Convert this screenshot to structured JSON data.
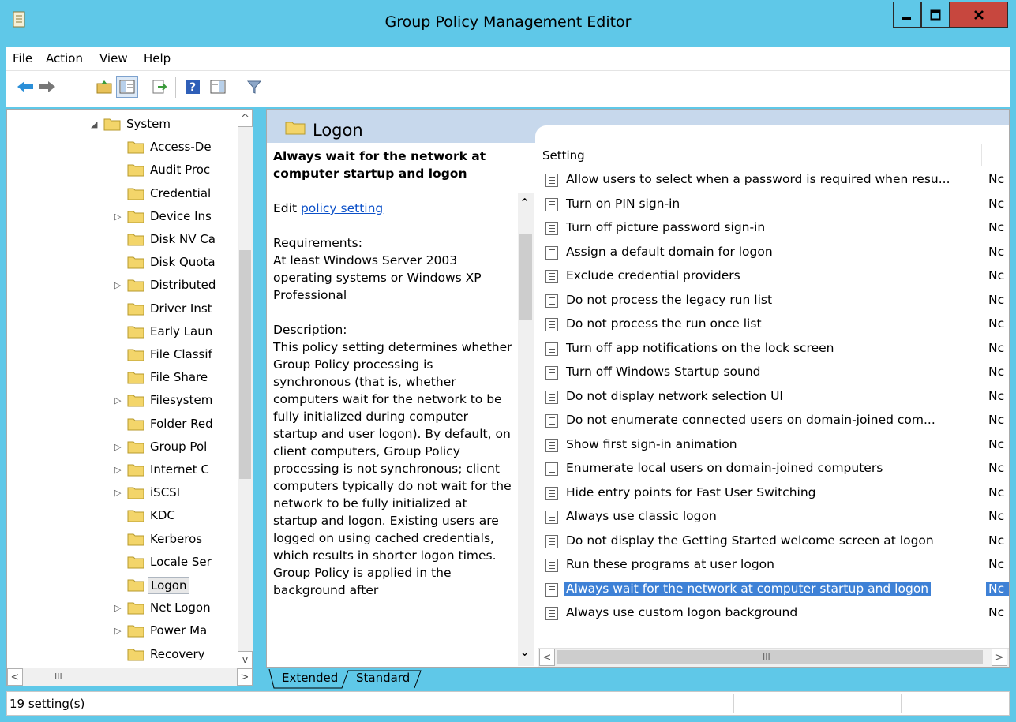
{
  "window": {
    "title": "Group Policy Management Editor"
  },
  "menubar": [
    "File",
    "Action",
    "View",
    "Help"
  ],
  "toolbar": {
    "icons": [
      "back-arrow-icon",
      "forward-arrow-icon",
      "up-folder-icon",
      "show-hide-tree-icon",
      "export-list-icon",
      "help-icon",
      "show-action-pane-icon",
      "filter-icon"
    ]
  },
  "tree": {
    "items": [
      {
        "label": "System",
        "expanded": true
      },
      {
        "label": "Access-De"
      },
      {
        "label": "Audit Proc"
      },
      {
        "label": "Credential"
      },
      {
        "label": "Device Ins",
        "collapsed": true
      },
      {
        "label": "Disk NV Ca"
      },
      {
        "label": "Disk Quota"
      },
      {
        "label": "Distributed",
        "collapsed": true
      },
      {
        "label": "Driver Inst"
      },
      {
        "label": "Early Laun"
      },
      {
        "label": "File Classif"
      },
      {
        "label": "File Share "
      },
      {
        "label": "Filesystem",
        "collapsed": true
      },
      {
        "label": "Folder Red"
      },
      {
        "label": "Group Pol",
        "collapsed": true
      },
      {
        "label": "Internet C",
        "collapsed": true
      },
      {
        "label": "iSCSI",
        "collapsed": true
      },
      {
        "label": "KDC"
      },
      {
        "label": "Kerberos"
      },
      {
        "label": "Locale Ser"
      },
      {
        "label": "Logon",
        "selected": true
      },
      {
        "label": "Net Logon",
        "collapsed": true
      },
      {
        "label": "Power Ma",
        "collapsed": true
      },
      {
        "label": "Recovery"
      }
    ]
  },
  "pane": {
    "title": "Logon",
    "description": {
      "heading": "Always wait for the network at computer startup and logon",
      "edit_prefix": "Edit ",
      "edit_link": "policy setting",
      "requirements_label": "Requirements:",
      "requirements_text": "At least Windows Server 2003 operating systems or Windows XP Professional",
      "description_label": "Description:",
      "description_text": "This policy setting determines whether Group Policy processing is synchronous (that is, whether computers wait for the network to be fully initialized during computer startup and user logon). By default, on client computers, Group Policy processing is not synchronous; client computers typically do not wait for the network to be fully initialized at startup and logon. Existing users are logged on using cached credentials, which results in shorter logon times. Group Policy is applied in the background after"
    },
    "column_setting": "Setting",
    "settings": [
      {
        "name": "Allow users to select when a password is required when resu...",
        "state": "Nc"
      },
      {
        "name": "Turn on PIN sign-in",
        "state": "Nc"
      },
      {
        "name": "Turn off picture password sign-in",
        "state": "Nc"
      },
      {
        "name": "Assign a default domain for logon",
        "state": "Nc"
      },
      {
        "name": "Exclude credential providers",
        "state": "Nc"
      },
      {
        "name": "Do not process the legacy run list",
        "state": "Nc"
      },
      {
        "name": "Do not process the run once list",
        "state": "Nc"
      },
      {
        "name": "Turn off app notifications on the lock screen",
        "state": "Nc"
      },
      {
        "name": "Turn off Windows Startup sound",
        "state": "Nc"
      },
      {
        "name": "Do not display network selection UI",
        "state": "Nc"
      },
      {
        "name": "Do not enumerate connected users on domain-joined com...",
        "state": "Nc"
      },
      {
        "name": "Show first sign-in animation",
        "state": "Nc"
      },
      {
        "name": "Enumerate local users on domain-joined computers",
        "state": "Nc"
      },
      {
        "name": "Hide entry points for Fast User Switching",
        "state": "Nc"
      },
      {
        "name": "Always use classic logon",
        "state": "Nc"
      },
      {
        "name": "Do not display the Getting Started welcome screen at logon",
        "state": "Nc"
      },
      {
        "name": "Run these programs at user logon",
        "state": "Nc"
      },
      {
        "name": "Always wait for the network at computer startup and logon",
        "state": "Nc",
        "selected": true
      },
      {
        "name": "Always use custom logon background",
        "state": "Nc"
      }
    ]
  },
  "tabs": [
    "Extended",
    "Standard"
  ],
  "status": {
    "text": "19 setting(s)"
  },
  "colors": {
    "titlebar": "#5fc8e8",
    "selection": "#3e81d6",
    "header": "#c7d8ec",
    "close": "#c7473e"
  }
}
